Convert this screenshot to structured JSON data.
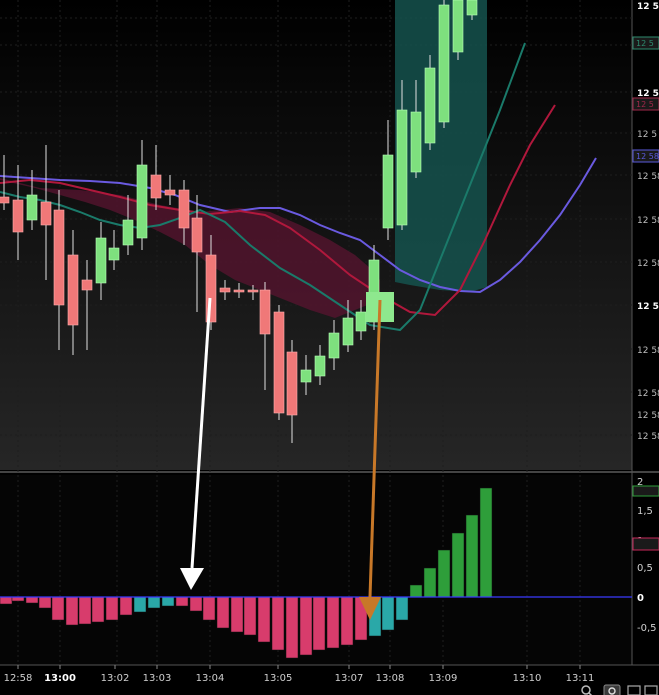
{
  "time_axis": {
    "labels": [
      {
        "text": "12:58",
        "bold": false
      },
      {
        "text": "13:00",
        "bold": true
      },
      {
        "text": "13:02",
        "bold": false
      },
      {
        "text": "13:03",
        "bold": false
      },
      {
        "text": "13:04",
        "bold": false
      },
      {
        "text": "13:05",
        "bold": false
      },
      {
        "text": "13:07",
        "bold": false
      },
      {
        "text": "13:08",
        "bold": false
      },
      {
        "text": "13:09",
        "bold": false
      },
      {
        "text": "13:10",
        "bold": false
      },
      {
        "text": "13:11",
        "bold": false
      }
    ]
  },
  "price_axis": {
    "labels": [
      "12 5",
      "12 5",
      "12 5",
      "12 58",
      "12 58",
      "12 58",
      "12 5",
      "12 58",
      "12 58",
      "12 58",
      "12 58"
    ],
    "badges": [
      {
        "text": "12 5",
        "color": "#2e8b6e"
      },
      {
        "text": "12 5",
        "color": "#a0284a"
      },
      {
        "text": "12 58",
        "color": "#5a5adc"
      }
    ]
  },
  "oscillator_axis": {
    "labels": [
      "2",
      "1,5",
      "1",
      "0,5",
      "0",
      "-0,5"
    ],
    "badge_color": "#c8285a"
  },
  "colors": {
    "bull_candle": "#7ee07e",
    "bear_candle": "#f07878",
    "ma_blue": "#6a5ae0",
    "ma_red": "#b0183c",
    "ma_teal": "#1a7a6a",
    "histogram_pink": "#d83c6c",
    "histogram_teal": "#2aa8a8",
    "histogram_green": "#2e9e3a",
    "zero_line": "#3a3aff",
    "arrow_white": "#ffffff",
    "arrow_orange": "#c87828"
  },
  "icons": [
    "search-icon",
    "settings-icon",
    "window-icon"
  ]
}
